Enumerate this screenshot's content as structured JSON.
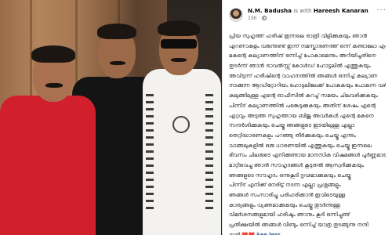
{
  "post": {
    "author": "N.M. Badusha",
    "with_text": "is with",
    "tagged": "Hareesh Kanaran",
    "timestamp": "15h",
    "icons": {
      "audience": "globe-icon",
      "options": "more-icon"
    },
    "body_lines": [
      "പ്രിയ സുഹൃത്ത് ഹരീഷ് ഇന്നലെ രാത്രി വിളിക്കുകയും ഞാൻ",
      "എറണാകുളം വരുന്നുണ്ട് ഇന്ന് നമസ്കാരണത്ത് ഒന്ന് കണ്ടാലോ എന്ന് ചോദിച്ചു",
      "മകന്റെ കല്യാണത്തിന് ഒന്നിച്ച് പോകാമെന്നും അറിയിച്ചതിനെ",
      "തുടർന്ന് ഞാൻ ട്രാവൽസ്സ് കോൾഡ് ഹോട്ടലിൽ എത്തുകയും",
      "അവിടുന്ന് ഹരീഷിന്റെ വാഹനത്തിൽ ഞങ്ങൾ ഒന്നിച്ച് കല്യാണ",
      "നടക്കുന്ന ആഡിറ്റോറിയം ഹോട്ടലിലേക്ക് പോകുകയും പോകുന്ന വഴി",
      "കലുങ്ങിലുള്ള എന്റെ ഓഫീസിൽ കുറച്ച് സമയം ചിലവഴിക്കുകയും",
      "പിന്നീട് കല്യാണത്തിൽ പങ്കെടുക്കുകയും അതിന് ശേഷം എന്റെ",
      "ഏറ്റവും അടുത്ത സുഹൃത്തായ ബിജു അവർകൾ എന്റെ മകനെ",
      "സന്ദർശിക്കുകയും ചെയ്തു ഞങ്ങളുടെ ഇടയിലുള്ള എല്ലാ",
      "തെറ്റിദ്ധാരണകളും പറഞ്ഞു തീർക്കുകയും ചെയ്തു എന്നും",
      "വാങ്ങലുകളിൽ ഒരു ധാരണയിൽ എത്തുകയും ചെയ്തു ഇന്നലെ",
      "ഭിവസം ചിലരുടെ എനിക്കുണ്ടായ മാനസിക വിഷമങ്ങൾ പൂർണ്ണമായും",
      "മാറ്റിവെച്ചു ഞാൻ സൗഹൃദങ്ങൾ കൂടുതൽ ആസ്വദിക്കുകയും",
      "ഞങ്ങളുടെ സൗഹൃദം ഒന്നുകൂടി ദൃഢമാക്കുകയും ചെയ്തു",
      "പിന്നീട് എനിക്ക് നേരിട്ട് നടന്ന എല്ലാ പ്രശ്നങ്ങളും",
      "ഞങ്ങൾ സംസാരിച്ചു പരിഹരിക്കാൻ ഇവിടെയുള്ള",
      "കാര്യങ്ങളും വ്യക്തമാക്കുകയും ചെയ്തു തുടർന്നുള്ള",
      "വിമർശനങ്ങളുമായി ഹരീഷും ഞാനും കൂടി ഒന്നിച്ചുണ്ട്",
      "പ്രതീക്ഷയിൽ ഞങ്ങൾ വീണ്ടും ഒന്നിച്ച് യാത്ര തുടങ്ങുന്നു നന്ദി"
    ],
    "end_text": "നന്ദി",
    "hearts": "❤️❤️",
    "see_more": "See less"
  }
}
